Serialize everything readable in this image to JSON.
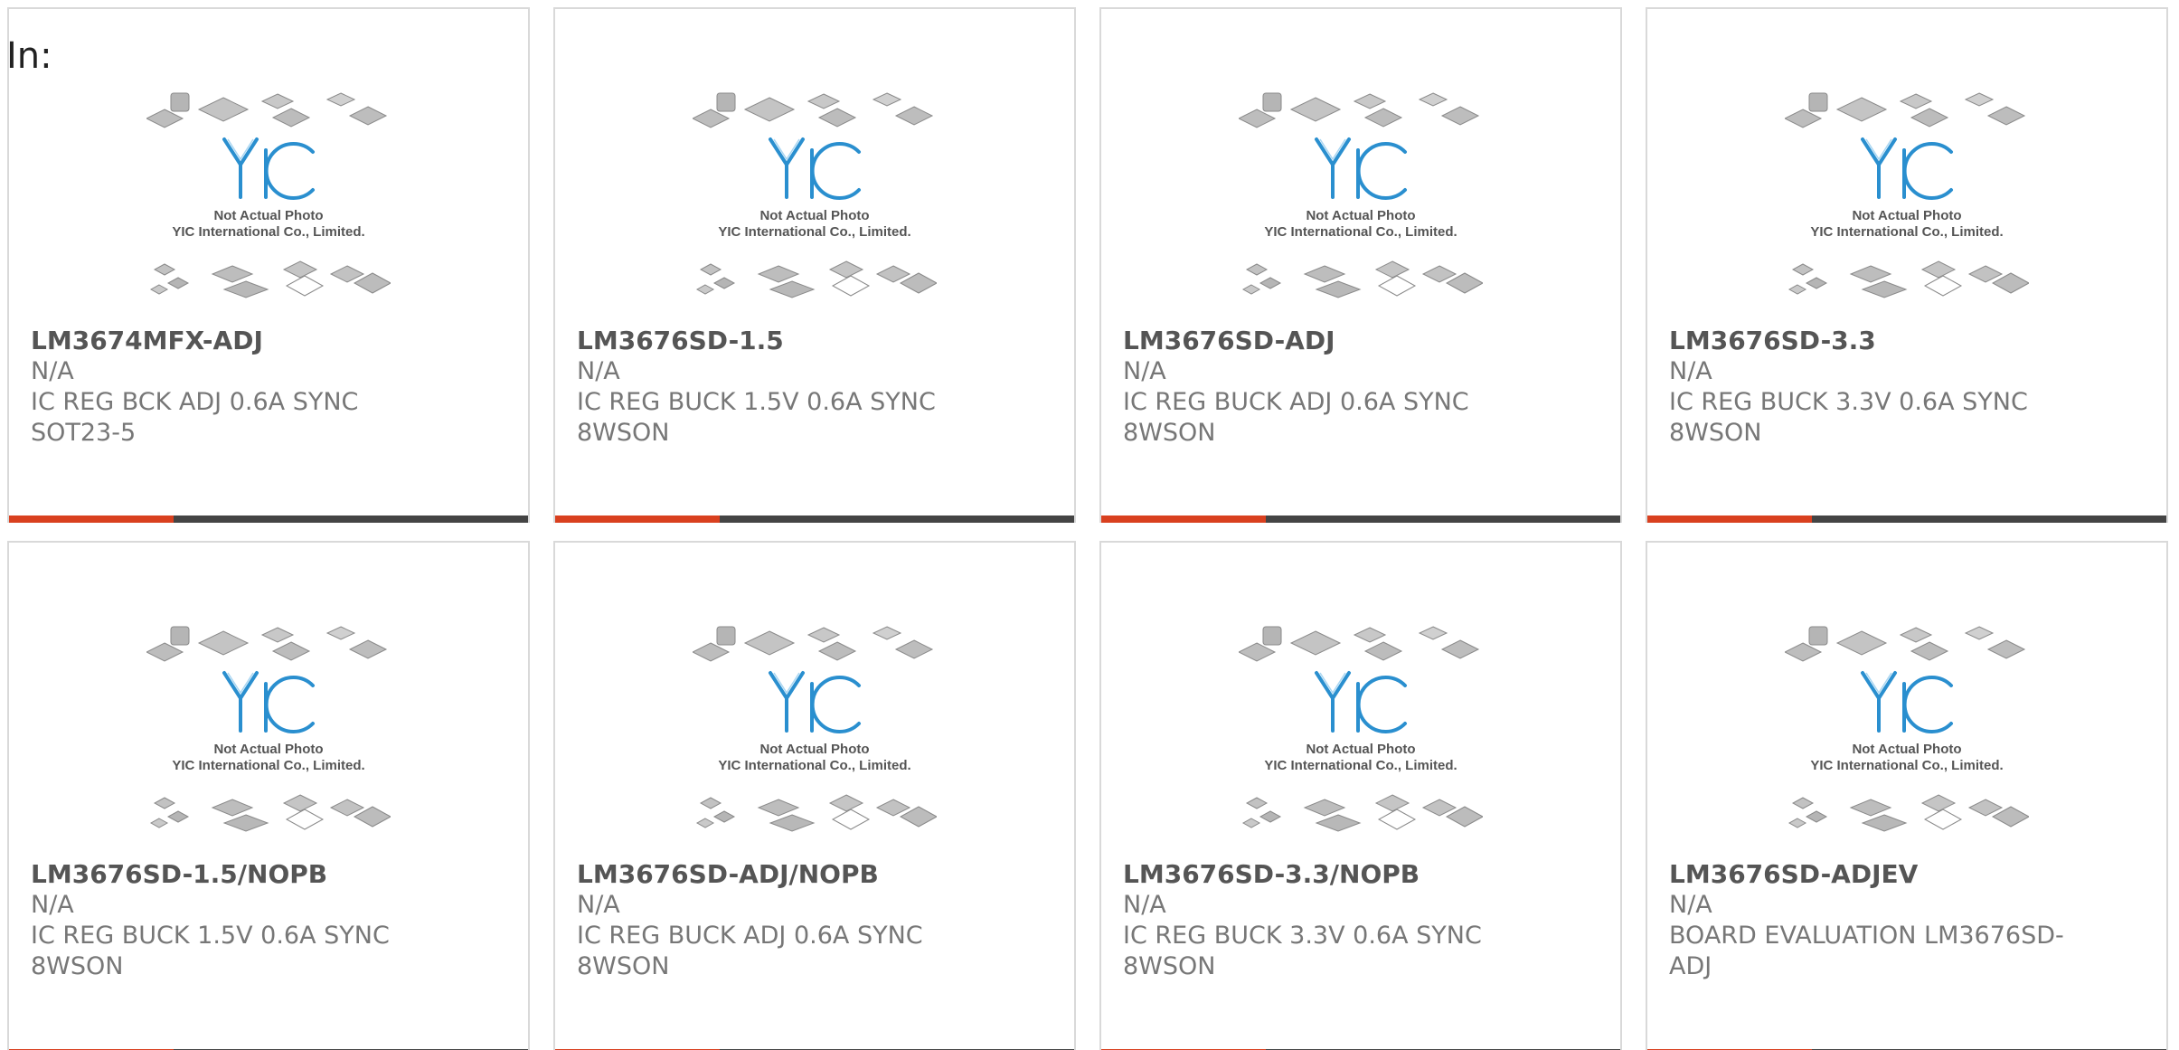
{
  "header": {
    "in_label": "In:"
  },
  "image_placeholder": {
    "line1": "Not Actual Photo",
    "line2": "YIC International Co., Limited.",
    "logo_text": "YIC"
  },
  "colors": {
    "accent": "#d9401f",
    "bar": "#444444",
    "logo": "#2a8fcf"
  },
  "products": [
    {
      "name": "LM3674MFX-ADJ",
      "manufacturer": "N/A",
      "description": "IC REG BCK ADJ 0.6A SYNC SOT23-5"
    },
    {
      "name": "LM3676SD-1.5",
      "manufacturer": "N/A",
      "description": "IC REG BUCK 1.5V 0.6A SYNC 8WSON"
    },
    {
      "name": "LM3676SD-ADJ",
      "manufacturer": "N/A",
      "description": "IC REG BUCK ADJ 0.6A SYNC 8WSON"
    },
    {
      "name": "LM3676SD-3.3",
      "manufacturer": "N/A",
      "description": "IC REG BUCK 3.3V 0.6A SYNC 8WSON"
    },
    {
      "name": "LM3676SD-1.5/NOPB",
      "manufacturer": "N/A",
      "description": "IC REG BUCK 1.5V 0.6A SYNC 8WSON"
    },
    {
      "name": "LM3676SD-ADJ/NOPB",
      "manufacturer": "N/A",
      "description": "IC REG BUCK ADJ 0.6A SYNC 8WSON"
    },
    {
      "name": "LM3676SD-3.3/NOPB",
      "manufacturer": "N/A",
      "description": "IC REG BUCK 3.3V 0.6A SYNC 8WSON"
    },
    {
      "name": "LM3676SD-ADJEV",
      "manufacturer": "N/A",
      "description": "BOARD EVALUATION LM3676SD-ADJ"
    }
  ]
}
